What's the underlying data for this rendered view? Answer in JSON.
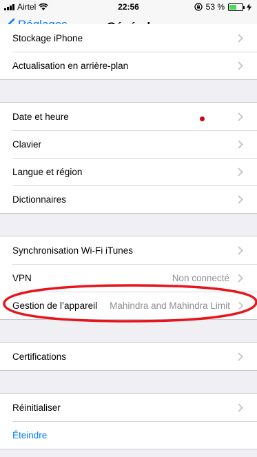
{
  "status_bar": {
    "carrier": "Airtel",
    "time": "22:56",
    "battery_percent": "53 %",
    "battery_level": 0.53,
    "icons": [
      "signal-icon",
      "wifi-icon",
      "rotation-lock-icon",
      "battery-icon",
      "charging-icon"
    ]
  },
  "nav": {
    "back_label": "Réglages",
    "title": "Général"
  },
  "groups": [
    {
      "rows": [
        {
          "label": "Stockage iPhone"
        },
        {
          "label": "Actualisation en arrière-plan"
        }
      ]
    },
    {
      "rows": [
        {
          "label": "Date et heure"
        },
        {
          "label": "Clavier"
        },
        {
          "label": "Langue et région"
        },
        {
          "label": "Dictionnaires"
        }
      ]
    },
    {
      "rows": [
        {
          "label": "Synchronisation Wi-Fi iTunes"
        },
        {
          "label": "VPN",
          "value": "Non connecté"
        },
        {
          "label": "Gestion de l’appareil",
          "value": "Mahindra and Mahindra Limited"
        }
      ]
    },
    {
      "rows": [
        {
          "label": "Certifications"
        }
      ]
    },
    {
      "rows": [
        {
          "label": "Réinitialiser"
        },
        {
          "label": "Éteindre"
        }
      ]
    }
  ],
  "annotation_color": "#e8141c",
  "accent_color": "#007aff"
}
